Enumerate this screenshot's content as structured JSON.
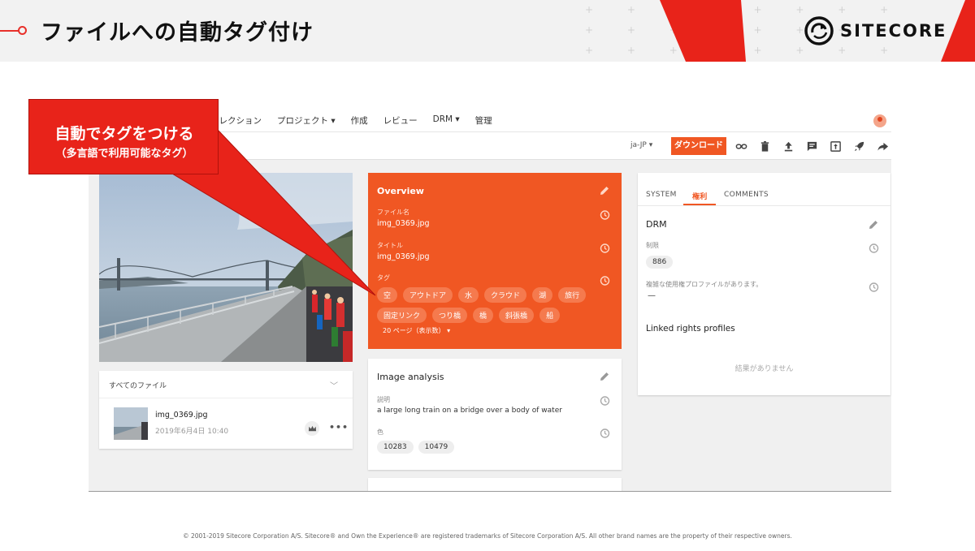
{
  "slide": {
    "title": "ファイルへの自動タグ付け",
    "logo_text": "SITECORE",
    "footer": "© 2001-2019 Sitecore Corporation A/S. Sitecore® and Own the Experience® are registered trademarks of Sitecore Corporation A/S. All other brand names are the property of their respective owners."
  },
  "callout": {
    "main": "自動でタグをつける",
    "sub": "（多言語で利用可能なタグ）",
    "color": "#e8231a"
  },
  "nav": {
    "items": [
      "コレクション",
      "プロジェクト ▾",
      "作成",
      "レビュー",
      "DRM ▾",
      "管理"
    ]
  },
  "toolbar": {
    "language": "ja-JP ▾",
    "download_label": "ダウンロード",
    "icons": [
      "link-icon",
      "trash-icon",
      "upload-icon",
      "comment-icon",
      "share-box-icon",
      "rocket-icon",
      "forward-icon"
    ]
  },
  "files": {
    "title": "すべてのファイル",
    "name": "img_0369.jpg",
    "date": "2019年6月4日 10:40"
  },
  "overview": {
    "title": "Overview",
    "filename_label": "ファイル名",
    "filename": "img_0369.jpg",
    "title_label": "タイトル",
    "title_value": "img_0369.jpg",
    "tags_label": "タグ",
    "tags": [
      "空",
      "アウトドア",
      "水",
      "クラウド",
      "湖",
      "旅行",
      "固定リンク",
      "つり橋",
      "橋",
      "斜張橋",
      "船"
    ],
    "pager": "20 ページ（表示数） ▾",
    "accent": "#f05723"
  },
  "analysis": {
    "title": "Image analysis",
    "desc_label": "説明",
    "description": "a large long train on a bridge over a body of water",
    "color_label": "色",
    "colors": [
      "10283",
      "10479"
    ]
  },
  "rights": {
    "tabs": [
      "SYSTEM",
      "権利",
      "COMMENTS"
    ],
    "drm_title": "DRM",
    "limit_label": "制限",
    "limit_value": "886",
    "profiles_note": "複雑な使用権プロファイルがあります。",
    "profiles_value": "—",
    "linked_title": "Linked rights profiles",
    "no_results": "結果がありません"
  }
}
